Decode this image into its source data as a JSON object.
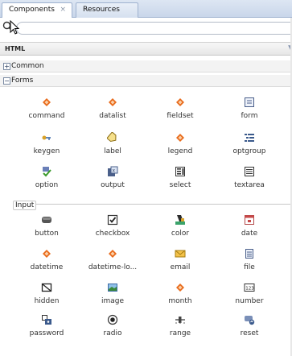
{
  "tabs": [
    {
      "label": "Components",
      "close": "×"
    },
    {
      "label": "Resources"
    }
  ],
  "search": {
    "value": "",
    "placeholder": ""
  },
  "palette_dropdown": {
    "selected": "HTML"
  },
  "categories": {
    "common": {
      "label": "Common",
      "toggle": "+"
    },
    "forms": {
      "label": "Forms",
      "toggle": "−"
    }
  },
  "forms_items": [
    "command",
    "datalist",
    "fieldset",
    "form",
    "keygen",
    "label",
    "legend",
    "optgroup",
    "option",
    "output",
    "select",
    "textarea"
  ],
  "input_group": {
    "label": "Input",
    "items": [
      "button",
      "checkbox",
      "color",
      "date",
      "datetime",
      "datetime-lo...",
      "email",
      "file",
      "hidden",
      "image",
      "month",
      "number",
      "password",
      "radio",
      "range",
      "reset"
    ]
  },
  "colors": {
    "tab_bar": "#c9d6ea",
    "html_tag_icon": "#e86a1a"
  }
}
